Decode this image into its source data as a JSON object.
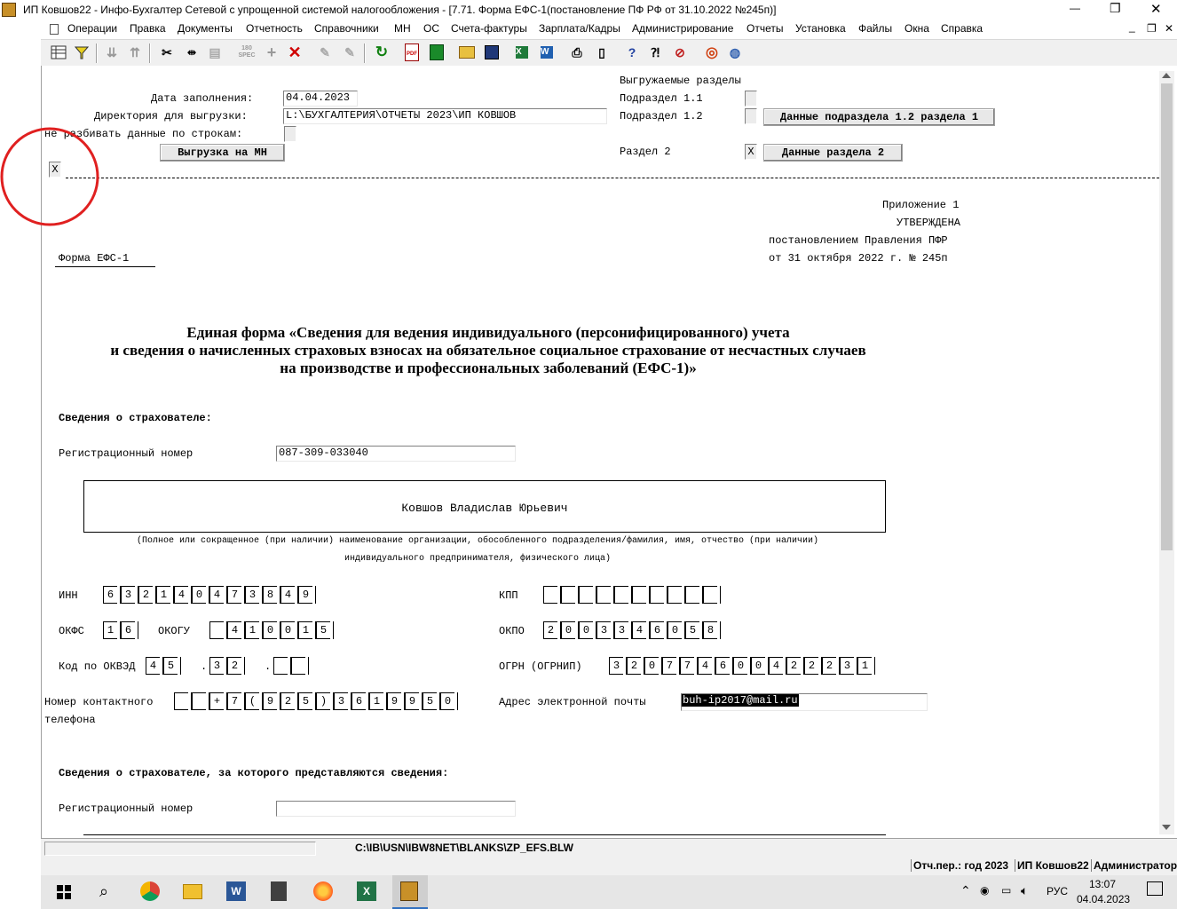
{
  "window": {
    "title": "ИП Ковшов22 - Инфо-Бухгалтер Сетевой с упрощенной системой налогообложения - [7.71.    Форма ЕФС-1(постановление ПФ РФ от 31.10.2022 №245п)]",
    "controls": {
      "minimize": "—",
      "restore": "❐",
      "close": "✕"
    }
  },
  "menu": {
    "items": [
      "Операции",
      "Правка",
      "Документы",
      "Отчетность",
      "Справочники",
      "МН",
      "ОС",
      "Счета-фактуры",
      "Зарплата/Кадры",
      "Администрирование",
      "Отчеты",
      "Установка",
      "Файлы",
      "Окна",
      "Справка"
    ],
    "right_controls": [
      "_",
      "❐",
      "✕"
    ]
  },
  "toolbar": {
    "icons": [
      "grid-icon",
      "filter-icon",
      "sort-asc-icon",
      "sort-desc-icon",
      "paste-icon",
      "rotate-180-icon",
      "add-icon",
      "delete-icon",
      "brush-icon",
      "brush2-icon",
      "cut-icon",
      "split-icon",
      "copy-icon",
      "refresh-icon",
      "pdf-icon",
      "calculator-icon",
      "open-folder-icon",
      "save-icon",
      "excel-icon",
      "word-icon",
      "print-icon",
      "preview-icon",
      "help-icon",
      "context-help-icon",
      "compass-icon",
      "lifebuoy-icon",
      "globe-icon"
    ],
    "rotate_label": "180\nSPEC",
    "pdf_label": "PDF"
  },
  "form": {
    "date_label": "Дата заполнения:",
    "date_value": "04.04.2023",
    "dir_label": "Директория для выгрузки:",
    "dir_value": "L:\\БУХГАЛТЕРИЯ\\ОТЧЕТЫ 2023\\ИП КОВШОВ",
    "split_label": "не разбивать данные по строкам:",
    "export_button": "Выгрузка на МН",
    "sections_title": "Выгружаемые разделы",
    "sub11_label": "Подраздел 1.1",
    "sub12_label": "Подраздел 1.2",
    "sub12_button": "Данные подраздела 1.2 раздела 1",
    "sec2_label": "Раздел 2",
    "sec2_check": "X",
    "sec2_button": "Данные раздела 2",
    "left_check": "X"
  },
  "doc": {
    "appendix": "Приложение 1",
    "approved": "УТВЕРЖДЕНА",
    "decree": "постановлением Правления ПФР",
    "decree_date": "от 31 октября 2022 г. № 245п",
    "form_name": "Форма ЕФС-1",
    "title_line1": "Единая форма «Сведения для ведения индивидуального (персонифицированного) учета",
    "title_line2": "и сведения о начисленных страховых взносах на обязательное социальное страхование от несчастных случаев",
    "title_line3": "на производстве и профессиональных заболеваний (ЕФС-1)»",
    "insurer_header": "Сведения о страхователе:",
    "reg_label": "Регистрационный номер",
    "reg_value": "087-309-033040",
    "org_name": "Ковшов Владислав Юрьевич",
    "org_note1": "(Полное или сокращенное (при наличии) наименование организации, обособленного подразделения/фамилия, имя, отчество (при наличии)",
    "org_note2": "индивидуального предпринимателя, физического лица)",
    "inn_label": "ИНН",
    "inn_digits": [
      "6",
      "3",
      "2",
      "1",
      "4",
      "0",
      "4",
      "7",
      "3",
      "8",
      "4",
      "9"
    ],
    "kpp_label": "КПП",
    "kpp_digits": [
      "",
      "",
      "",
      "",
      "",
      "",
      "",
      "",
      "",
      ""
    ],
    "okfs_label": "ОКФС",
    "okfs_digits": [
      "1",
      "6"
    ],
    "okogu_label": "ОКОГУ",
    "okogu_digits": [
      "",
      "4",
      "1",
      "0",
      "0",
      "1",
      "5"
    ],
    "okpo_label": "ОКПО",
    "okpo_digits": [
      "2",
      "0",
      "0",
      "3",
      "3",
      "4",
      "6",
      "0",
      "5",
      "8"
    ],
    "okved_label": "Код по ОКВЭД",
    "okved_g1": [
      "4",
      "5"
    ],
    "okved_g2": [
      "3",
      "2"
    ],
    "okved_g3": [
      "",
      ""
    ],
    "ogrn_label": "ОГРН (ОГРНИП)",
    "ogrn_digits": [
      "3",
      "2",
      "0",
      "7",
      "7",
      "4",
      "6",
      "0",
      "0",
      "4",
      "2",
      "2",
      "2",
      "3",
      "1"
    ],
    "phone_label1": "Номер контактного",
    "phone_label2": "телефона",
    "phone_digits": [
      "",
      "",
      "+",
      "7",
      "(",
      "9",
      "2",
      "5",
      ")",
      "3",
      "6",
      "1",
      "9",
      "9",
      "5",
      "0"
    ],
    "email_label": "Адрес электронной почты",
    "email_value": "buh-ip2017@mail.ru",
    "insurer2_header": "Сведения о страхователе, за которого представляются сведения:",
    "reg2_label": "Регистрационный номер",
    "reg2_value": ""
  },
  "status": {
    "path": "C:\\IB\\USN\\IBW8NET\\BLANKS\\ZP_EFS.BLW",
    "period": "Отч.пер.: год 2023",
    "company": "ИП Ковшов22",
    "user": "Администратор"
  },
  "taskbar": {
    "lang": "РУС",
    "time": "13:07",
    "date": "04.04.2023"
  },
  "colors": {
    "annotation_circle": "#e02020",
    "taskbar": "#e6e6e6",
    "email_highlight": "#000000"
  }
}
